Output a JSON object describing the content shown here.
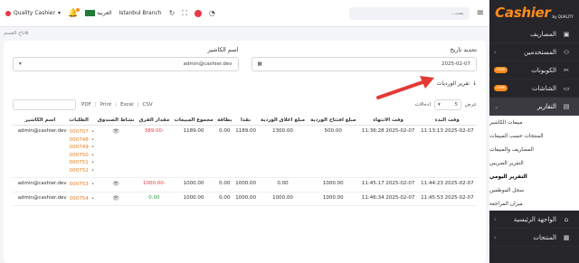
{
  "header": {
    "brand_label": "Quality Cashier",
    "language_label": "العربية",
    "branch_label": "Istanbul Branch",
    "search_placeholder": "بحث..."
  },
  "breadcrumb": {
    "label": "تاج القسم"
  },
  "filters": {
    "date_label": "تحديد تاريخ",
    "date_value": "2025-02-07",
    "cashier_label": "اسم الكاشير",
    "cashier_value": "admin@cashier.dev"
  },
  "report": {
    "label": "تقرير الورديات"
  },
  "controls": {
    "show_label": "عرض",
    "show_value": "5",
    "entries_label": "ادخالات",
    "export": [
      "PDF",
      "Print",
      "Excel",
      "CSV"
    ]
  },
  "table": {
    "headers": [
      "وقت البدء",
      "وقت الانتهاء",
      "مبلغ افتتاح الوردية",
      "مبلغ اغلاق الوردية",
      "نقدا",
      "بطاقة",
      "مجموع المبيعات",
      "مقدار الفرق",
      "نشاط الصندوق",
      "",
      "الطلبات",
      "اسم الكاشير"
    ],
    "rows": [
      {
        "start": "2025-02-07 11:13:13",
        "end": "2025-02-07 11:36:28",
        "opening": "500.00",
        "closing": "1300.00",
        "cash": "1189.00",
        "card": "0.00",
        "sales": "1189.00",
        "diff": "-389.00",
        "orders": [
          "000707",
          "000748",
          "000749",
          "000750",
          "000751",
          "000752"
        ],
        "cashier": "admin@cashier.dev"
      },
      {
        "start": "2025-02-07 11:44:23",
        "end": "2025-02-07 11:45:17",
        "opening": "1000.00",
        "closing": "0.00",
        "cash": "1000.00",
        "card": "0.00",
        "sales": "1000.00",
        "diff": "-1000.00",
        "orders": [
          "000753"
        ],
        "cashier": "admin@cashier.dev"
      },
      {
        "start": "2025-02-07 11:45:53",
        "end": "2025-02-07 11:46:34",
        "opening": "1000.00",
        "closing": "1000.00",
        "cash": "1000.00",
        "card": "0.00",
        "sales": "1000.00",
        "diff": "0.00",
        "orders": [
          "000754"
        ],
        "cashier": "admin@cashier.dev"
      }
    ]
  },
  "sidebar": {
    "logo": "Cashier",
    "logo_sub": "by QUALITY",
    "items": [
      {
        "label": "المصاريف",
        "icon": "wallet-icon"
      },
      {
        "label": "المستخدمين",
        "icon": "users-icon"
      },
      {
        "label": "الكوبونات",
        "icon": "coupon-icon",
        "badge": "new"
      },
      {
        "label": "الشاشات",
        "icon": "monitor-icon",
        "badge": "new"
      },
      {
        "label": "التقارير",
        "icon": "report-icon"
      }
    ],
    "subitems": [
      "مبيعات الكاشير",
      "المنتجات حسب المبيعات",
      "المصاريف والمبيعات",
      "التقرير الضريبي",
      "التقرير اليومي",
      "سجل الموظفين",
      "ميزان المراجعة"
    ],
    "bottom_items": [
      {
        "label": "الواجهة الرئيسية",
        "icon": "home-icon"
      },
      {
        "label": "المنتجات",
        "icon": "box-icon"
      }
    ]
  },
  "colors": {
    "accent": "#ff8c1a",
    "sidebar_bg": "#26252a",
    "negative": "#e63946",
    "positive": "#2e9e44",
    "link": "#e67e22"
  }
}
